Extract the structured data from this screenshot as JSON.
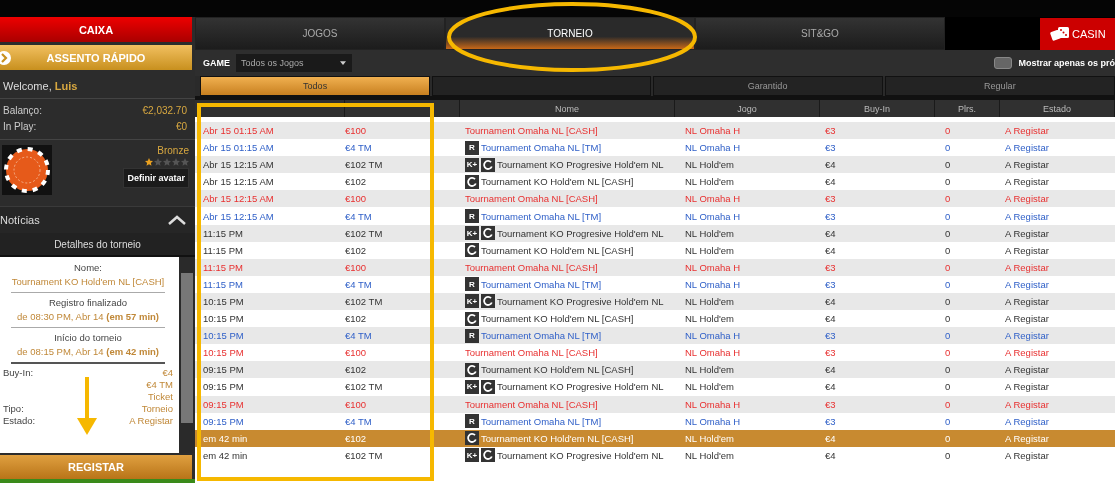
{
  "sidebar": {
    "cashier_button": "CAIXA",
    "quick_seat_button": "ASSENTO RÁPIDO",
    "welcome": {
      "greeting": "Welcome,",
      "name": "Luis"
    },
    "balance": [
      {
        "label": "Balanço:",
        "value": "€2,032.70"
      },
      {
        "label": "In Play:",
        "value": "€0"
      }
    ],
    "profile": {
      "level": "Bronze",
      "stars": 1,
      "avatar_button": "Definir avatar"
    },
    "news": {
      "title": "Notícias",
      "expanded": true
    },
    "details": {
      "title": "Detalhes do torneio",
      "name_label": "Nome:",
      "name": "Tournament KO Hold'em NL [CASH]",
      "sections": [
        {
          "label": "Registro finalizado",
          "value": "de 08:30 PM, Abr 14 **(em 57 min)**"
        },
        {
          "label": "Início do torneio",
          "value": "de 08:15 PM, Abr 14 **(em 42 min)**"
        }
      ],
      "fields": [
        {
          "label": "Buy-In:",
          "values": [
            "€4",
            "€4 TM",
            "Ticket"
          ]
        },
        {
          "label": "Tipo:",
          "values": [
            "Torneio"
          ]
        },
        {
          "label": "Estado:",
          "values": [
            "A Registar"
          ]
        }
      ]
    },
    "register_button": "REGISTAR"
  },
  "tabs": [
    {
      "label": "JOGOS",
      "selected": false
    },
    {
      "label": "TORNEIO",
      "selected": true
    },
    {
      "label": "SIT&GO",
      "selected": false
    }
  ],
  "casino_button": "CASIN",
  "filter": {
    "label": "GAME",
    "value": "Todos os Jogos",
    "upcoming_only": {
      "label": "Mostrar apenas os pró",
      "checked": false
    }
  },
  "sub_tabs": [
    {
      "label": "Todos",
      "selected": true
    },
    {
      "label": "Garantido",
      "selected": false
    },
    {
      "label": "Regular",
      "selected": false
    }
  ],
  "table": {
    "columns": [
      "Nome",
      "Jogo",
      "Buy-In",
      "Plrs.",
      "Estado"
    ],
    "rows": [
      {
        "kind": "cash",
        "selected": false,
        "time": "Abr 15 01:15 AM",
        "fee": "€100",
        "badges": [],
        "name": "Tournament Omaha NL [CASH]",
        "game": "NL Omaha H",
        "buyin": "€3",
        "players": "0",
        "status": "A Registar"
      },
      {
        "kind": "tm",
        "selected": false,
        "time": "Abr 15 01:15 AM",
        "fee": "€4 TM",
        "badges": [
          {
            "kind": "text",
            "label": "R"
          }
        ],
        "name": "Tournament Omaha NL [TM]",
        "game": "NL Omaha H",
        "buyin": "€3",
        "players": "0",
        "status": "A Registar"
      },
      {
        "kind": "regular",
        "selected": false,
        "time": "Abr 15 12:15 AM",
        "fee": "€102 TM",
        "badges": [
          {
            "kind": "text",
            "label": "K+"
          },
          {
            "kind": "icon"
          }
        ],
        "name": "Tournament KO Progresive Hold'em NL",
        "game": "NL Hold'em",
        "buyin": "€4",
        "players": "0",
        "status": "A Registar"
      },
      {
        "kind": "regular",
        "selected": false,
        "time": "Abr 15 12:15 AM",
        "fee": "€102",
        "badges": [
          {
            "kind": "icon"
          }
        ],
        "name": "Tournament KO Hold'em NL [CASH]",
        "game": "NL Hold'em",
        "buyin": "€4",
        "players": "0",
        "status": "A Registar"
      },
      {
        "kind": "cash",
        "selected": false,
        "time": "Abr 15 12:15 AM",
        "fee": "€100",
        "badges": [],
        "name": "Tournament Omaha NL [CASH]",
        "game": "NL Omaha H",
        "buyin": "€3",
        "players": "0",
        "status": "A Registar"
      },
      {
        "kind": "tm",
        "selected": false,
        "time": "Abr 15 12:15 AM",
        "fee": "€4 TM",
        "badges": [
          {
            "kind": "text",
            "label": "R"
          }
        ],
        "name": "Tournament Omaha NL [TM]",
        "game": "NL Omaha H",
        "buyin": "€3",
        "players": "0",
        "status": "A Registar"
      },
      {
        "kind": "regular",
        "selected": false,
        "time": "11:15 PM",
        "fee": "€102 TM",
        "badges": [
          {
            "kind": "text",
            "label": "K+"
          },
          {
            "kind": "icon"
          }
        ],
        "name": "Tournament KO Progresive Hold'em NL",
        "game": "NL Hold'em",
        "buyin": "€4",
        "players": "0",
        "status": "A Registar"
      },
      {
        "kind": "regular",
        "selected": false,
        "time": "11:15 PM",
        "fee": "€102",
        "badges": [
          {
            "kind": "icon"
          }
        ],
        "name": "Tournament KO Hold'em NL [CASH]",
        "game": "NL Hold'em",
        "buyin": "€4",
        "players": "0",
        "status": "A Registar"
      },
      {
        "kind": "cash",
        "selected": false,
        "time": "11:15 PM",
        "fee": "€100",
        "badges": [],
        "name": "Tournament Omaha NL [CASH]",
        "game": "NL Omaha H",
        "buyin": "€3",
        "players": "0",
        "status": "A Registar"
      },
      {
        "kind": "tm",
        "selected": false,
        "time": "11:15 PM",
        "fee": "€4 TM",
        "badges": [
          {
            "kind": "text",
            "label": "R"
          }
        ],
        "name": "Tournament Omaha NL [TM]",
        "game": "NL Omaha H",
        "buyin": "€3",
        "players": "0",
        "status": "A Registar"
      },
      {
        "kind": "regular",
        "selected": false,
        "time": "10:15 PM",
        "fee": "€102 TM",
        "badges": [
          {
            "kind": "text",
            "label": "K+"
          },
          {
            "kind": "icon"
          }
        ],
        "name": "Tournament KO Progresive Hold'em NL",
        "game": "NL Hold'em",
        "buyin": "€4",
        "players": "0",
        "status": "A Registar"
      },
      {
        "kind": "regular",
        "selected": false,
        "time": "10:15 PM",
        "fee": "€102",
        "badges": [
          {
            "kind": "icon"
          }
        ],
        "name": "Tournament KO Hold'em NL [CASH]",
        "game": "NL Hold'em",
        "buyin": "€4",
        "players": "0",
        "status": "A Registar"
      },
      {
        "kind": "tm",
        "selected": false,
        "time": "10:15 PM",
        "fee": "€4 TM",
        "badges": [
          {
            "kind": "text",
            "label": "R"
          }
        ],
        "name": "Tournament Omaha NL [TM]",
        "game": "NL Omaha H",
        "buyin": "€3",
        "players": "0",
        "status": "A Registar"
      },
      {
        "kind": "cash",
        "selected": false,
        "time": "10:15 PM",
        "fee": "€100",
        "badges": [],
        "name": "Tournament Omaha NL [CASH]",
        "game": "NL Omaha H",
        "buyin": "€3",
        "players": "0",
        "status": "A Registar"
      },
      {
        "kind": "regular",
        "selected": false,
        "time": "09:15 PM",
        "fee": "€102",
        "badges": [
          {
            "kind": "icon"
          }
        ],
        "name": "Tournament KO Hold'em NL [CASH]",
        "game": "NL Hold'em",
        "buyin": "€4",
        "players": "0",
        "status": "A Registar"
      },
      {
        "kind": "regular",
        "selected": false,
        "time": "09:15 PM",
        "fee": "€102 TM",
        "badges": [
          {
            "kind": "text",
            "label": "K+"
          },
          {
            "kind": "icon"
          }
        ],
        "name": "Tournament KO Progresive Hold'em NL",
        "game": "NL Hold'em",
        "buyin": "€4",
        "players": "0",
        "status": "A Registar"
      },
      {
        "kind": "cash",
        "selected": false,
        "time": "09:15 PM",
        "fee": "€100",
        "badges": [],
        "name": "Tournament Omaha NL [CASH]",
        "game": "NL Omaha H",
        "buyin": "€3",
        "players": "0",
        "status": "A Registar"
      },
      {
        "kind": "tm",
        "selected": false,
        "time": "09:15 PM",
        "fee": "€4 TM",
        "badges": [
          {
            "kind": "text",
            "label": "R"
          }
        ],
        "name": "Tournament Omaha NL [TM]",
        "game": "NL Omaha H",
        "buyin": "€3",
        "players": "0",
        "status": "A Registar"
      },
      {
        "kind": "regular",
        "selected": true,
        "time": "em 42 min",
        "fee": "€102",
        "badges": [
          {
            "kind": "icon"
          }
        ],
        "name": "Tournament KO Hold'em NL [CASH]",
        "game": "NL Hold'em",
        "buyin": "€4",
        "players": "0",
        "status": "A Registar"
      },
      {
        "kind": "regular",
        "selected": false,
        "time": "em 42 min",
        "fee": "€102 TM",
        "badges": [
          {
            "kind": "text",
            "label": "K+"
          },
          {
            "kind": "icon"
          }
        ],
        "name": "Tournament KO Progresive Hold'em NL",
        "game": "NL Hold'em",
        "buyin": "€4",
        "players": "0",
        "status": "A Registar"
      }
    ]
  }
}
